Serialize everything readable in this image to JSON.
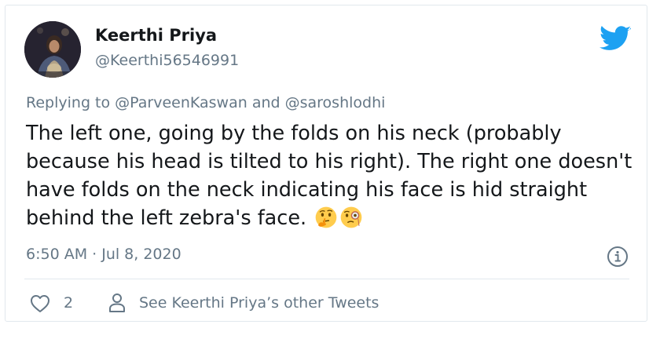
{
  "author": {
    "name": "Keerthi Priya",
    "handle": "@Keerthi56546991"
  },
  "reply": {
    "prefix": "Replying to ",
    "mention_1": "@ParveenKaswan",
    "conjunction": " and ",
    "mention_2": "@saroshlodhi"
  },
  "tweet": {
    "text": "The left one, going by the folds on his neck (probably because his head is tilted to his right). The right one doesn't have folds on the neck indicating his face is hid straight behind the left zebra's face. ",
    "emojis": [
      "thinking-face",
      "face-with-monocle"
    ]
  },
  "meta": {
    "timestamp": "6:50 AM · Jul 8, 2020"
  },
  "actions": {
    "like_count": "2",
    "other_tweets_label": "See Keerthi Priya’s other Tweets"
  },
  "icons": [
    "twitter-logo-icon",
    "info-icon",
    "heart-icon",
    "person-icon"
  ],
  "colors": {
    "twitter_blue": "#1da1f2",
    "text_primary": "#14171a",
    "text_secondary": "#657786",
    "border": "#e1e8ed"
  }
}
